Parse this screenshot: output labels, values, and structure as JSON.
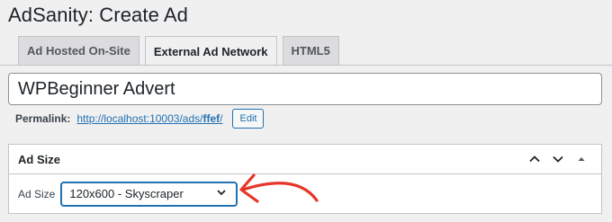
{
  "page": {
    "title": "AdSanity: Create Ad"
  },
  "tabs": [
    {
      "label": "Ad Hosted On-Site",
      "active": false
    },
    {
      "label": "External Ad Network",
      "active": true
    },
    {
      "label": "HTML5",
      "active": false
    }
  ],
  "title_field": {
    "value": "WPBeginner Advert"
  },
  "permalink": {
    "label": "Permalink:",
    "url_base": "http://localhost:10003/ads/",
    "slug": "ffef",
    "url_tail": "/",
    "edit_label": "Edit"
  },
  "ad_size_box": {
    "title": "Ad Size",
    "field_label": "Ad Size",
    "selected": "120x600 - Skyscraper"
  },
  "icons": {
    "move_up": "chevron-up-icon",
    "move_down": "chevron-down-icon",
    "toggle": "triangle-up-icon",
    "select_arrow": "chevron-down-icon",
    "annotation": "red-arrow-icon"
  },
  "colors": {
    "accent": "#2271b1",
    "annotation": "#e8352a"
  }
}
